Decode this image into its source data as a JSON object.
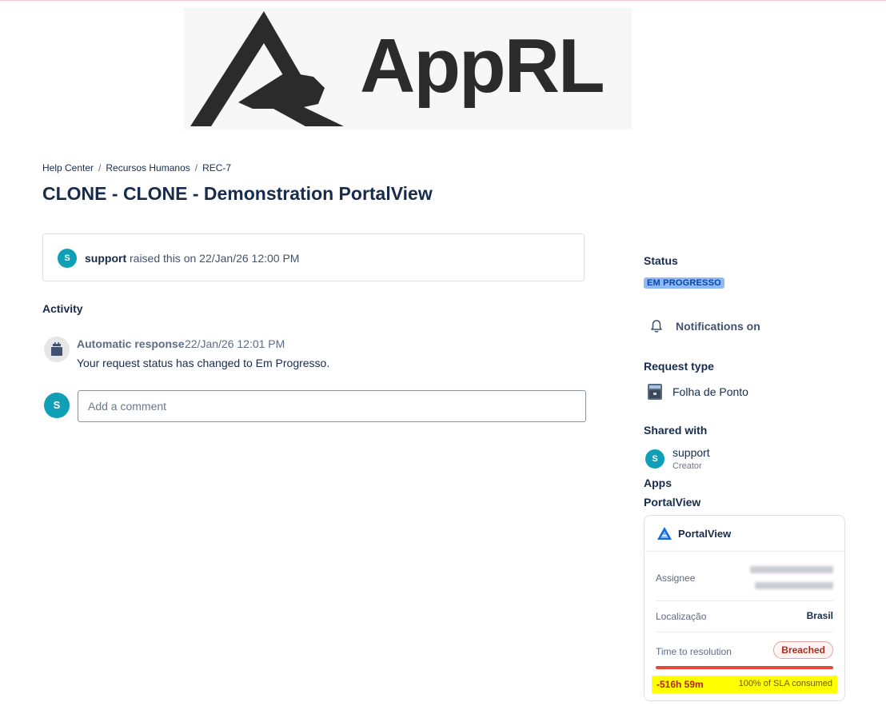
{
  "logo": {
    "text": "AppRL"
  },
  "breadcrumb": {
    "items": [
      "Help Center",
      "Recursos Humanos",
      "REC-7"
    ],
    "separator": "/"
  },
  "page_title": "CLONE - CLONE - Demonstration PortalView",
  "raised": {
    "avatar_letter": "S",
    "user": "support",
    "text": "raised this on 22/Jan/26 12:00 PM"
  },
  "activity": {
    "heading": "Activity",
    "entry": {
      "author": "Automatic response",
      "time": "22/Jan/26 12:01 PM",
      "body": "Your request status has changed to Em Progresso."
    },
    "comment": {
      "avatar_letter": "S",
      "placeholder": "Add a comment"
    }
  },
  "sidebar": {
    "status_label": "Status",
    "status_value": "EM PROGRESSO",
    "notifications": "Notifications on",
    "request_type_label": "Request type",
    "request_type_value": "Folha de Ponto",
    "shared_label": "Shared with",
    "shared_user": {
      "avatar_letter": "S",
      "name": "support",
      "role": "Creator"
    },
    "apps_label": "Apps",
    "app_link": "PortalView"
  },
  "app_card": {
    "title": "PortalView",
    "assignee_label": "Assignee",
    "location_label": "Localização",
    "location_value": "Brasil",
    "ttr_label": "Time to resolution",
    "ttr_status": "Breached",
    "sla_time": "-516h 59m",
    "sla_consumed": "100% of SLA consumed",
    "sla_fraction": 1.0
  },
  "colors": {
    "accent_teal": "#0f9fb6",
    "status_badge_bg": "#8fb8f6",
    "breached_red": "#e5493a",
    "highlight_yellow": "#ffff00"
  }
}
